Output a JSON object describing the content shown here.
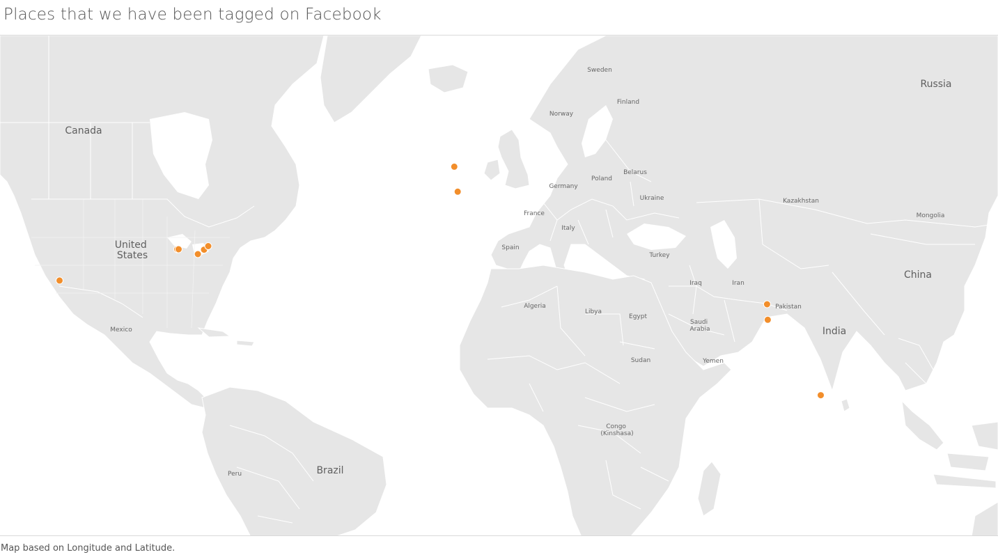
{
  "title": "Places that we have been tagged on Facebook",
  "caption": "Map based on Longitude and Latitude.",
  "colors": {
    "land": "#e6e6e6",
    "water": "#ffffff",
    "border": "#ffffff",
    "marker": "#f28e2b",
    "text": "#555555"
  },
  "labels": {
    "canada": "Canada",
    "united_states": "United\nStates",
    "mexico": "Mexico",
    "brazil": "Brazil",
    "peru": "Peru",
    "russia": "Russia",
    "china": "China",
    "india": "India",
    "kazakhstan": "Kazakhstan",
    "mongolia": "Mongolia",
    "sweden": "Sweden",
    "finland": "Finland",
    "norway": "Norway",
    "germany": "Germany",
    "poland": "Poland",
    "belarus": "Belarus",
    "ukraine": "Ukraine",
    "france": "France",
    "italy": "Italy",
    "spain": "Spain",
    "turkey": "Turkey",
    "iraq": "Iraq",
    "iran": "Iran",
    "pakistan": "Pakistan",
    "saudi_arabia": "Saudi\nArabia",
    "yemen": "Yemen",
    "algeria": "Algeria",
    "libya": "Libya",
    "egypt": "Egypt",
    "sudan": "Sudan",
    "congo": "Congo\n(Kinshasa)"
  },
  "markers": [
    {
      "lon": -117.2,
      "lat": 32.7
    },
    {
      "lon": -83.0,
      "lat": 40.0
    },
    {
      "lon": -82.6,
      "lat": 40.0
    },
    {
      "lon": -77.0,
      "lat": 38.9
    },
    {
      "lon": -75.2,
      "lat": 39.9
    },
    {
      "lon": -74.0,
      "lat": 40.7
    },
    {
      "lon": -2.5,
      "lat": 55.9
    },
    {
      "lon": -1.5,
      "lat": 51.6
    },
    {
      "lon": 88.4,
      "lat": 26.7
    },
    {
      "lon": 88.6,
      "lat": 22.6
    },
    {
      "lon": 104.0,
      "lat": 1.3
    }
  ]
}
